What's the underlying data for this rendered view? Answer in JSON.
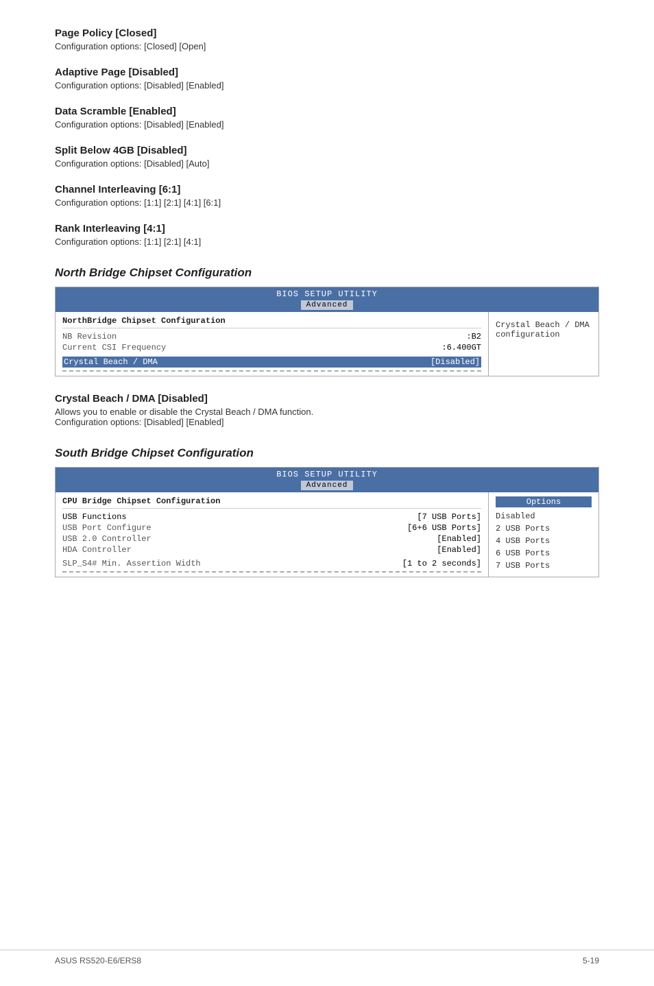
{
  "sections": [
    {
      "id": "page-policy",
      "title": "Page Policy [Closed]",
      "desc": "Configuration options: [Closed] [Open]"
    },
    {
      "id": "adaptive-page",
      "title": "Adaptive Page [Disabled]",
      "desc": "Configuration options: [Disabled] [Enabled]"
    },
    {
      "id": "data-scramble",
      "title": "Data Scramble [Enabled]",
      "desc": "Configuration options: [Disabled] [Enabled]"
    },
    {
      "id": "split-below",
      "title": "Split Below 4GB [Disabled]",
      "desc": "Configuration options: [Disabled] [Auto]"
    },
    {
      "id": "channel-interleaving",
      "title": "Channel Interleaving [6:1]",
      "desc": "Configuration options: [1:1] [2:1] [4:1] [6:1]"
    },
    {
      "id": "rank-interleaving",
      "title": "Rank Interleaving [4:1]",
      "desc": "Configuration options: [1:1] [2:1] [4:1]"
    }
  ],
  "north_bridge": {
    "heading": "North Bridge Chipset Configuration",
    "bios_header": "BIOS SETUP UTILITY",
    "tab_label": "Advanced",
    "section_title": "NorthBridge Chipset Configuration",
    "rows": [
      {
        "label": "NB Revision",
        "value": ":B2"
      },
      {
        "label": "Current CSI Frequency",
        "value": ":6.400GT"
      }
    ],
    "selected_label": "Crystal Beach / DMA",
    "selected_value": "[Disabled]",
    "sidebar_text": "Crystal Beach / DMA\nconfiguration"
  },
  "crystal_beach": {
    "title": "Crystal Beach / DMA [Disabled]",
    "desc1": "Allows you to enable or disable the Crystal Beach / DMA function.",
    "desc2": "Configuration options: [Disabled] [Enabled]"
  },
  "south_bridge": {
    "heading": "South Bridge Chipset Configuration",
    "bios_header": "BIOS SETUP UTILITY",
    "tab_label": "Advanced",
    "section_title": "CPU Bridge Chipset Configuration",
    "rows": [
      {
        "label": "USB Functions",
        "value": "[7 USB Ports]"
      },
      {
        "label": "USB Port Configure",
        "value": "[6+6 USB Ports]"
      },
      {
        "label": "USB 2.0 Controller",
        "value": "[Enabled]"
      },
      {
        "label": "HDA Controller",
        "value": "[Enabled]"
      },
      {
        "label": "",
        "value": ""
      },
      {
        "label": "SLP_S4# Min. Assertion Width",
        "value": "[1 to 2 seconds]"
      }
    ],
    "options_header": "Options",
    "options": [
      "Disabled",
      "2 USB Ports",
      "4 USB Ports",
      "6 USB Ports",
      "7 USB Ports"
    ]
  },
  "footer": {
    "left": "ASUS RS520-E6/ERS8",
    "right": "5-19"
  }
}
